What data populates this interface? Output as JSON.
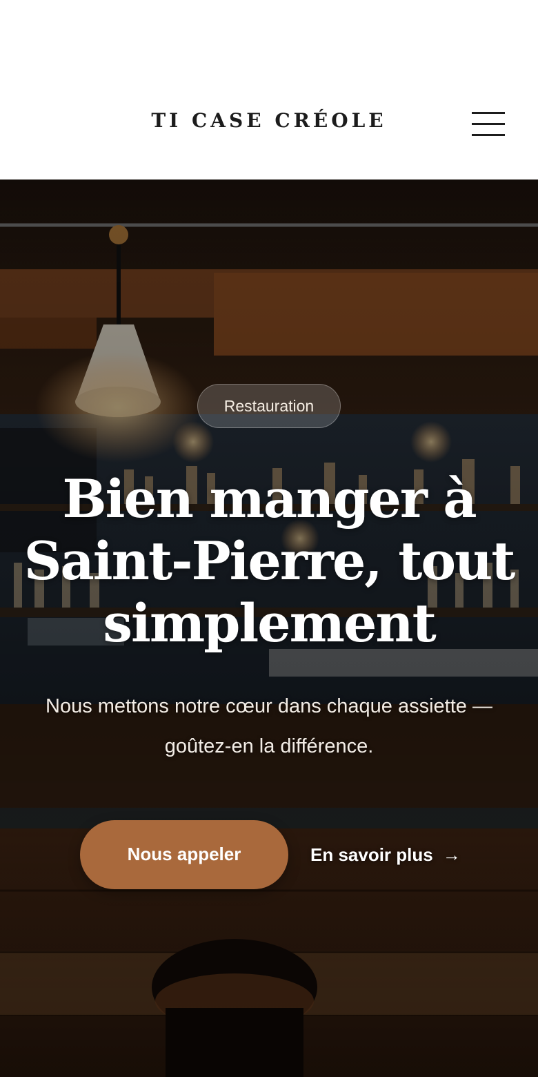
{
  "header": {
    "brand": "TI CASE CRÉOLE",
    "menu_icon": "hamburger-menu-icon"
  },
  "hero": {
    "badge": "Restauration",
    "title": "Bien manger à Saint-Pierre, tout simplement",
    "subtitle": "Nous mettons notre cœur dans chaque assiette — goûtez-en la différence.",
    "primary_button": "Nous appeler",
    "secondary_button": "En savoir plus",
    "secondary_arrow": "→",
    "secondary_icon": "arrow-right-icon",
    "background_image": "restaurant-bar-interior-photo"
  },
  "colors": {
    "accent": "#a9693c",
    "text_dark": "#1c1c1c",
    "header_bg": "#ffffff"
  }
}
